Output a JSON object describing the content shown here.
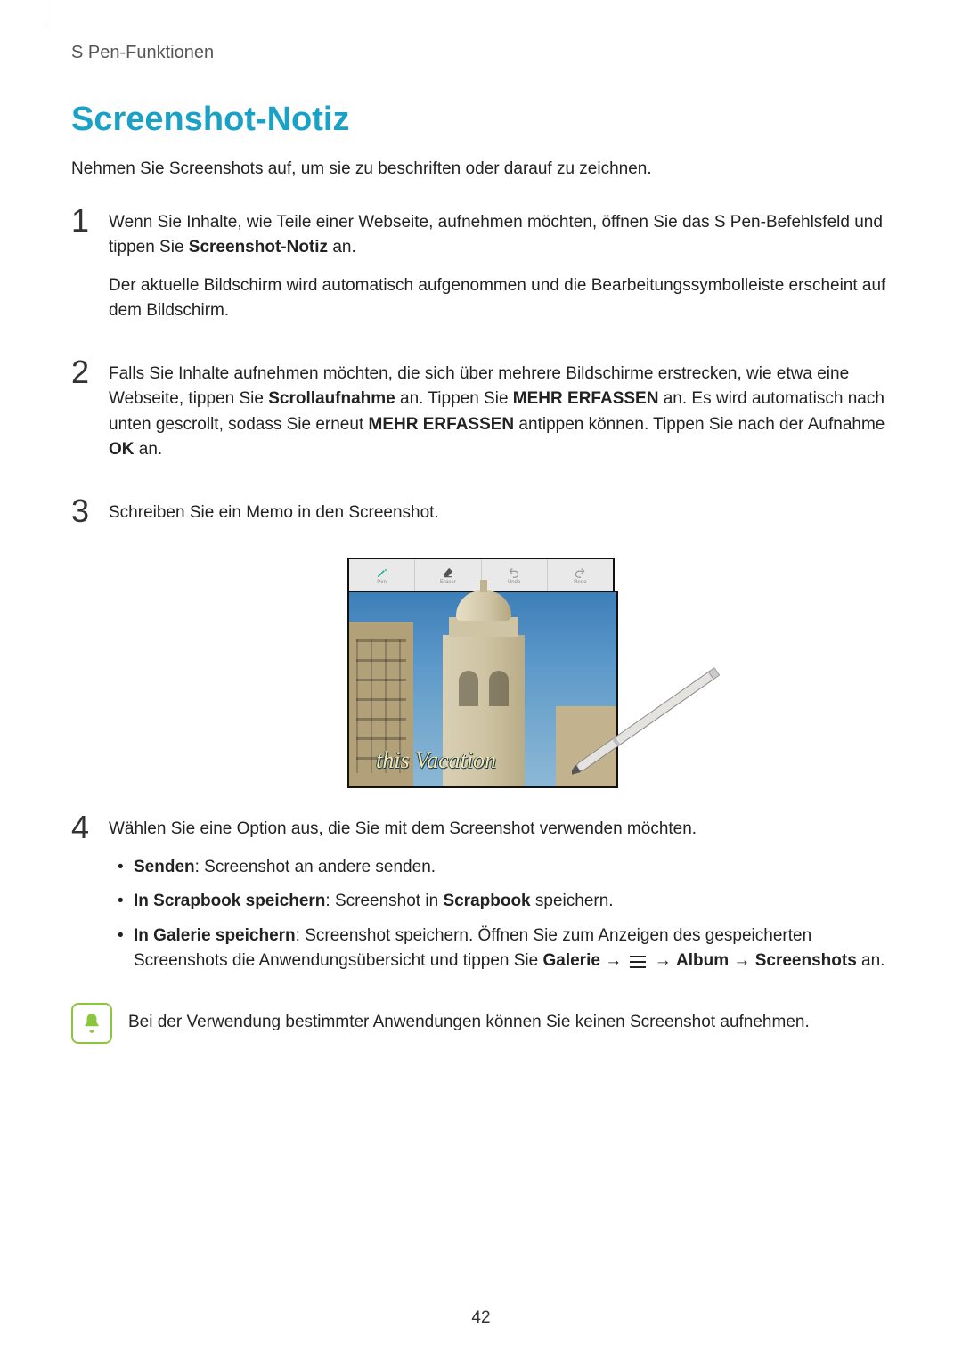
{
  "section_label": "S Pen-Funktionen",
  "title": "Screenshot-Notiz",
  "intro": "Nehmen Sie Screenshots auf, um sie zu beschriften oder darauf zu zeichnen.",
  "steps": {
    "1": {
      "num": "1",
      "p1_a": "Wenn Sie Inhalte, wie Teile einer Webseite, aufnehmen möchten, öffnen Sie das S Pen-Befehlsfeld und tippen Sie ",
      "p1_b_bold": "Screenshot-Notiz",
      "p1_c": " an.",
      "p2": "Der aktuelle Bildschirm wird automatisch aufgenommen und die Bearbeitungssymbolleiste erscheint auf dem Bildschirm."
    },
    "2": {
      "num": "2",
      "a": "Falls Sie Inhalte aufnehmen möchten, die sich über mehrere Bildschirme erstrecken, wie etwa eine Webseite, tippen Sie ",
      "b_bold": "Scrollaufnahme",
      "c": " an. Tippen Sie ",
      "d_bold": "MEHR ERFASSEN",
      "e": " an. Es wird automatisch nach unten gescrollt, sodass Sie erneut ",
      "f_bold": "MEHR ERFASSEN",
      "g": " antippen können. Tippen Sie nach der Aufnahme ",
      "h_bold": "OK",
      "i": " an."
    },
    "3": {
      "num": "3",
      "text": "Schreiben Sie ein Memo in den Screenshot."
    },
    "4": {
      "num": "4",
      "text": "Wählen Sie eine Option aus, die Sie mit dem Screenshot verwenden möchten."
    }
  },
  "figure": {
    "handwriting": "this Vacation",
    "toolbar": {
      "pen": "Pen",
      "eraser": "Eraser",
      "undo": "Undo",
      "redo": "Redo"
    }
  },
  "options": {
    "send": {
      "bold": "Senden",
      "rest": ": Screenshot an andere senden."
    },
    "scrapbook": {
      "bold": "In Scrapbook speichern",
      "mid": ": Screenshot in ",
      "bold2": "Scrapbook",
      "rest": " speichern."
    },
    "gallery": {
      "bold": "In Galerie speichern",
      "a": ": Screenshot speichern. Öffnen Sie zum Anzeigen des gespeicherten Screenshots die Anwendungsübersicht und tippen Sie ",
      "b_bold": "Galerie",
      "arrow1": " → ",
      "arrow2": " → ",
      "c_bold": "Album",
      "arrow3": " → ",
      "d_bold": "Screenshots",
      "e": " an."
    }
  },
  "note": "Bei der Verwendung bestimmter Anwendungen können Sie keinen Screenshot aufnehmen.",
  "page_number": "42"
}
